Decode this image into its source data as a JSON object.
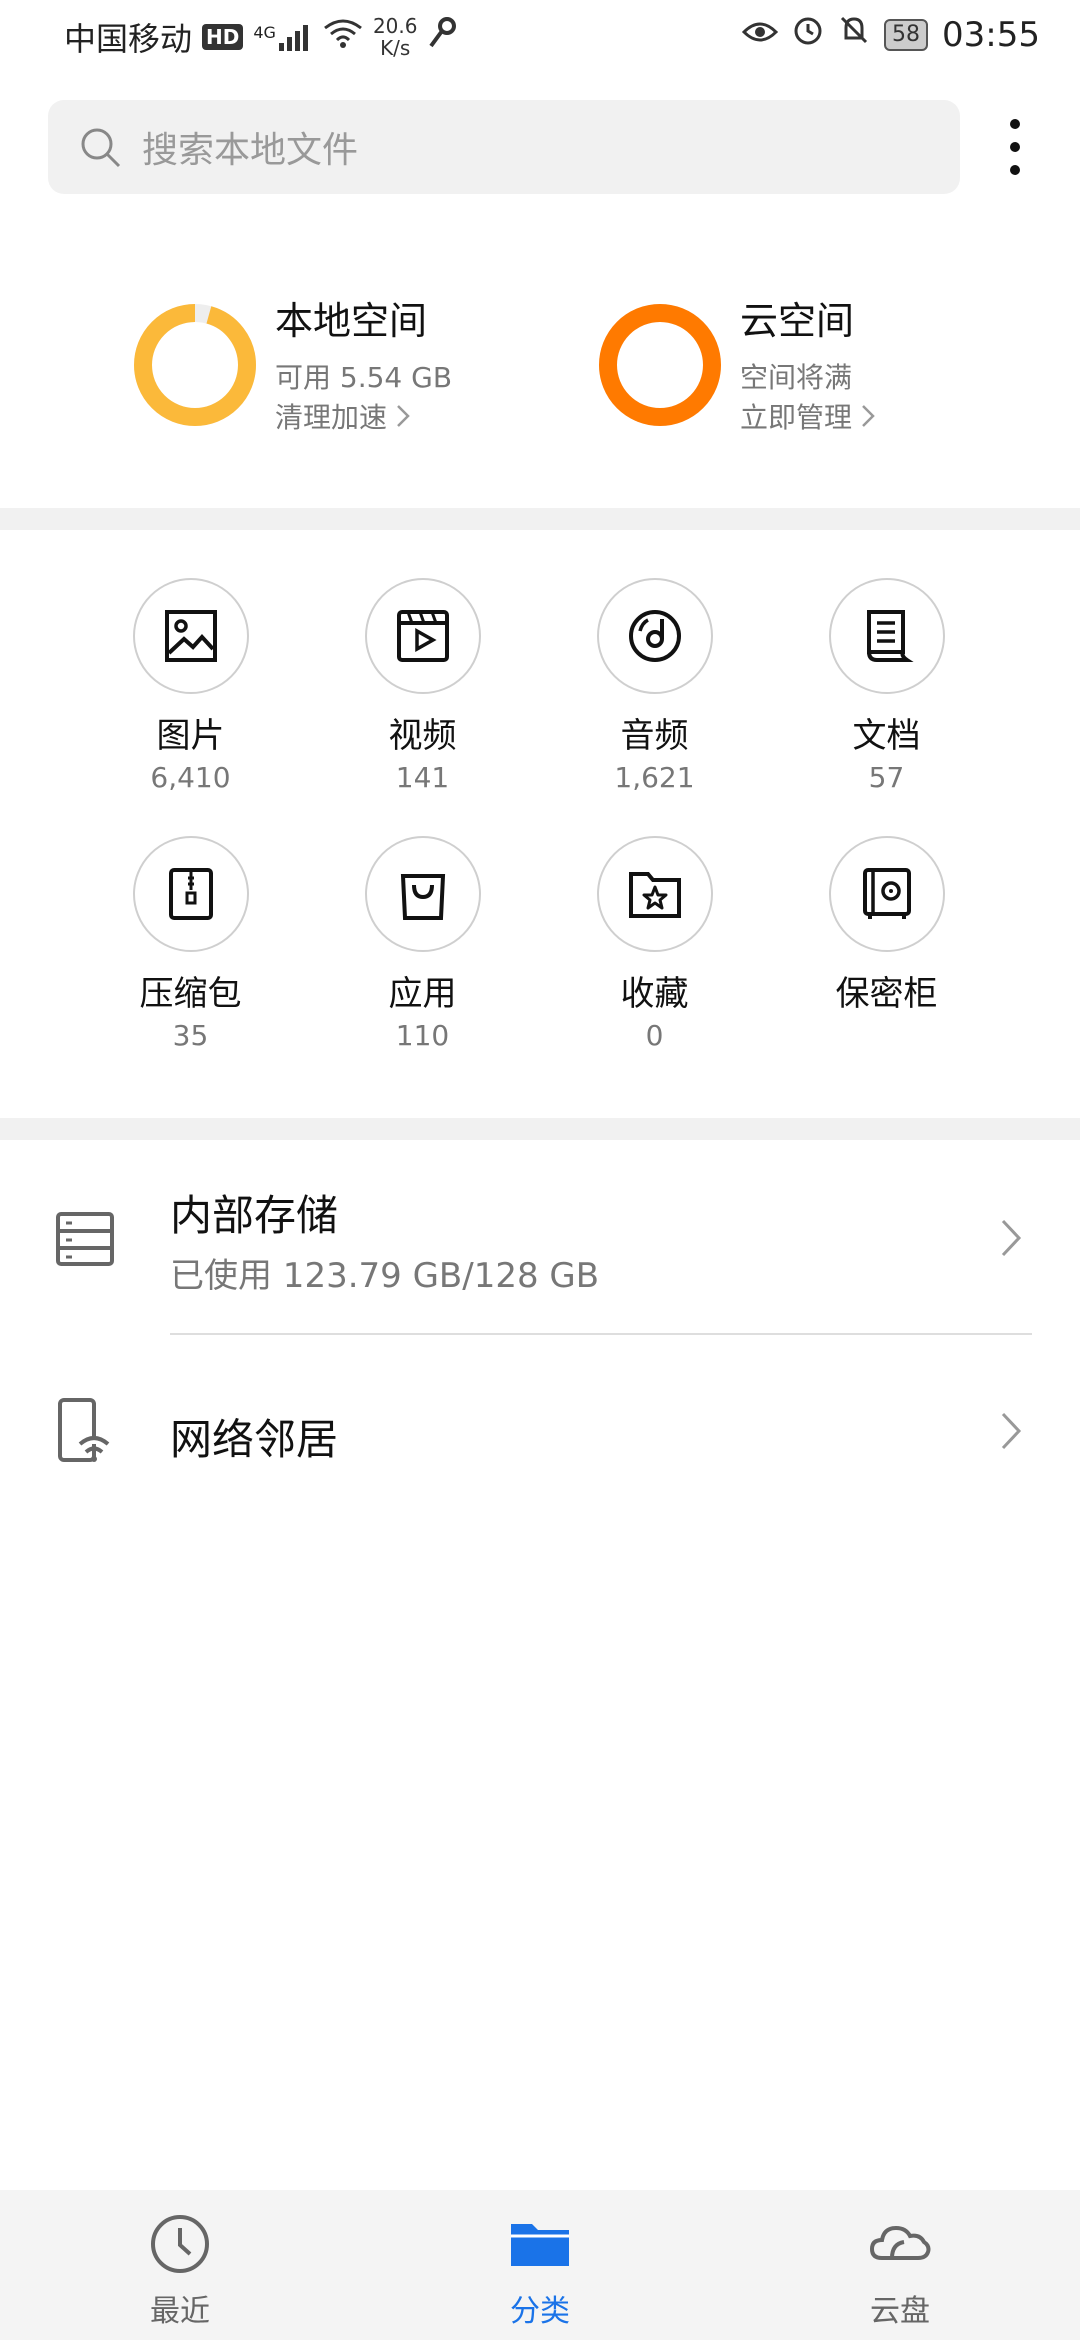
{
  "status_bar": {
    "carrier": "中国移动",
    "hd": "HD",
    "network": "4G",
    "speed_value": "20.6",
    "speed_unit": "K/s",
    "battery": "58",
    "time": "03:55"
  },
  "search": {
    "placeholder": "搜索本地文件"
  },
  "summary": {
    "local": {
      "title": "本地空间",
      "sub": "可用 5.54 GB",
      "action": "清理加速",
      "used_fraction": 0.957,
      "color": "#FBB93A"
    },
    "cloud": {
      "title": "云空间",
      "sub": "空间将满",
      "action": "立即管理",
      "used_fraction": 1.0,
      "color": "#FF7A00"
    }
  },
  "categories": [
    {
      "name": "图片",
      "count": "6,410",
      "icon": "image-icon"
    },
    {
      "name": "视频",
      "count": "141",
      "icon": "video-icon"
    },
    {
      "name": "音频",
      "count": "1,621",
      "icon": "audio-icon"
    },
    {
      "name": "文档",
      "count": "57",
      "icon": "document-icon"
    },
    {
      "name": "压缩包",
      "count": "35",
      "icon": "archive-icon"
    },
    {
      "name": "应用",
      "count": "110",
      "icon": "app-bag-icon"
    },
    {
      "name": "收藏",
      "count": "0",
      "icon": "favorites-folder-icon"
    },
    {
      "name": "保密柜",
      "count": "",
      "icon": "safe-icon"
    }
  ],
  "storage_list": {
    "internal": {
      "title": "内部存储",
      "sub": "已使用 123.79 GB/128 GB"
    },
    "network": {
      "title": "网络邻居"
    }
  },
  "tabs": [
    {
      "label": "最近",
      "icon": "clock-icon"
    },
    {
      "label": "分类",
      "icon": "folder-icon",
      "active": true
    },
    {
      "label": "云盘",
      "icon": "cloud-icon"
    }
  ],
  "colors": {
    "accent": "#1a73e8",
    "local_ring": "#FBB93A",
    "cloud_ring": "#FF7A00"
  }
}
